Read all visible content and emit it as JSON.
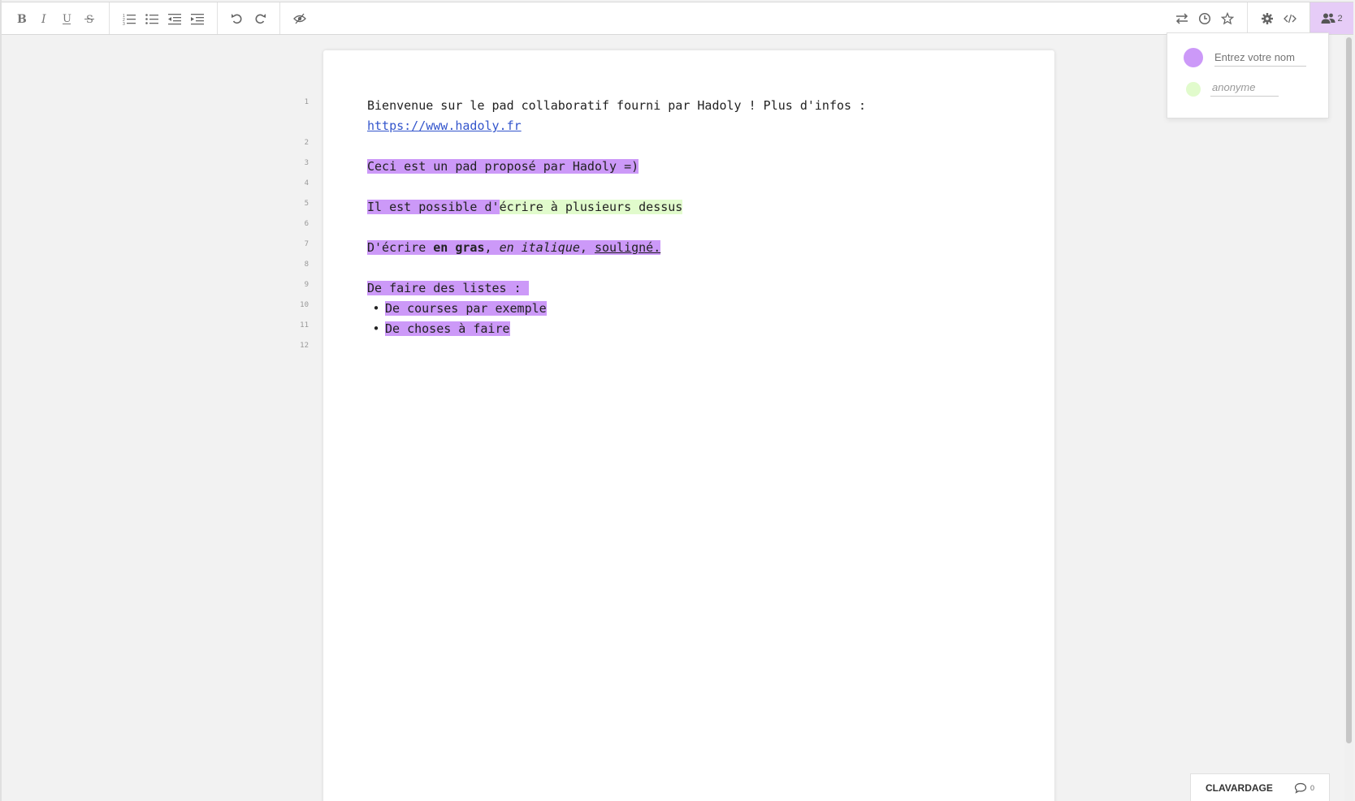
{
  "toolbar": {
    "users_count": "2"
  },
  "line_numbers": [
    "1",
    "2",
    "3",
    "4",
    "5",
    "6",
    "7",
    "8",
    "9",
    "10",
    "11",
    "12"
  ],
  "pad": {
    "line1_text": "Bienvenue sur le pad collaboratif fourni par Hadoly ! Plus d'infos :",
    "line1_link": "https://www.hadoly.fr",
    "line3": "Ceci est un pad proposé par Hadoly =)",
    "line5_purple": "Il est possible d'",
    "line5_green": "écrire à plusieurs dessus",
    "line7_a": "D'écrire ",
    "line7_bold": "en gras",
    "line7_sep1": ", ",
    "line7_italic": "en italique",
    "line7_sep2": ", ",
    "line7_underline": "souligné.",
    "line9": "De faire des listes : ",
    "list_items": [
      "De courses par exemple",
      "De choses à faire"
    ]
  },
  "users_popup": {
    "my_name_placeholder": "Entrez votre nom",
    "my_name_value": "",
    "other_user_name": "anonyme",
    "my_color": "#cc99f8",
    "other_color": "#e1fbcc"
  },
  "chat": {
    "label": "CLAVARDAGE",
    "count": "0"
  },
  "colors": {
    "accent_purple": "#cc99f8",
    "accent_green": "#e1fbcc",
    "link": "#3355cc"
  }
}
